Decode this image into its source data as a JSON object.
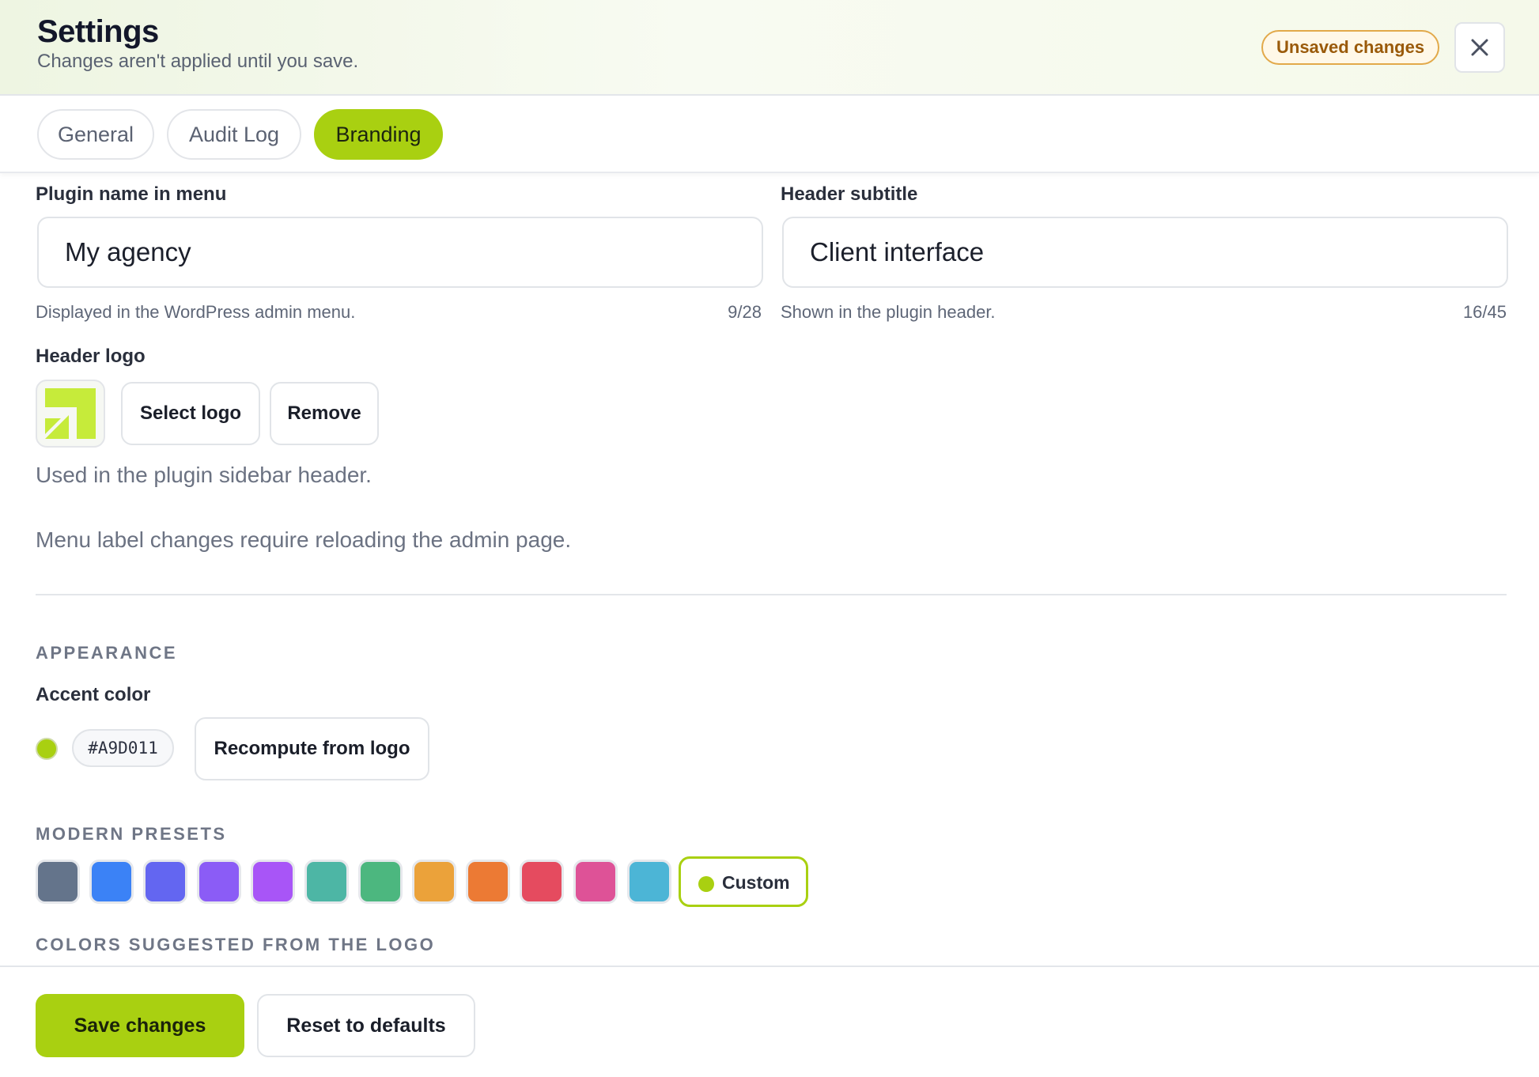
{
  "header": {
    "title": "Settings",
    "subtitle": "Changes aren't applied until you save.",
    "badge": "Unsaved changes",
    "close_icon": "close-icon"
  },
  "tabs": [
    {
      "label": "General",
      "active": false
    },
    {
      "label": "Audit Log",
      "active": false
    },
    {
      "label": "Branding",
      "active": true
    }
  ],
  "branding": {
    "plugin_name": {
      "label": "Plugin name in menu",
      "value": "My agency",
      "hint": "Displayed in the WordPress admin menu.",
      "counter": "9/28"
    },
    "header_subtitle": {
      "label": "Header subtitle",
      "value": "Client interface",
      "hint": "Shown in the plugin header.",
      "counter": "16/45"
    },
    "logo": {
      "label": "Header logo",
      "select_label": "Select logo",
      "remove_label": "Remove",
      "hint": "Used in the plugin sidebar header.",
      "logo_color": "#C6EB3A"
    },
    "reload_note": "Menu label changes require reloading the admin page."
  },
  "appearance": {
    "section_title": "APPEARANCE",
    "accent_label": "Accent color",
    "accent_hex": "#A9D011",
    "recompute_label": "Recompute from logo",
    "presets_title": "MODERN PRESETS",
    "presets": [
      "#64748B",
      "#3B82F6",
      "#6366F1",
      "#8B5CF6",
      "#A855F7",
      "#4DB6A5",
      "#4CB77F",
      "#EBA23A",
      "#EC7A34",
      "#E54B5F",
      "#DE5297",
      "#4CB5D6"
    ],
    "custom_label": "Custom",
    "suggested_title": "COLORS SUGGESTED FROM THE LOGO"
  },
  "footer": {
    "save_label": "Save changes",
    "reset_label": "Reset to defaults"
  }
}
